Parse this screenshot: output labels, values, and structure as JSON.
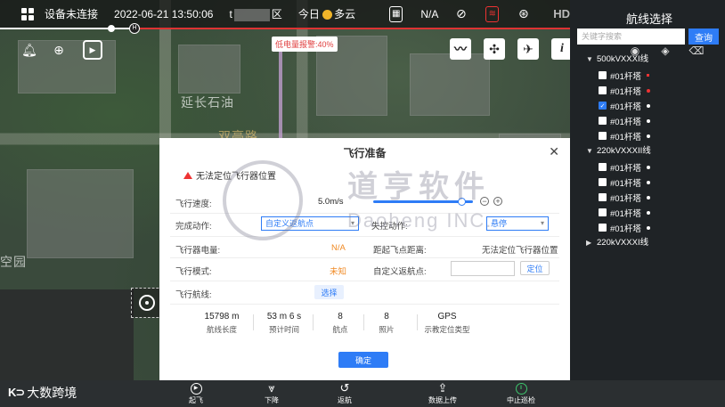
{
  "topbar": {
    "device_status": "设备未连接",
    "datetime": "2022-06-21  13:50:06",
    "district_prefix": "t",
    "district_suffix": "区",
    "weather_day": "今日",
    "weather": "多云",
    "gps_value": "N/A",
    "hd_label": "HD"
  },
  "map": {
    "low_battery_warning": "低电量报警:40%",
    "labels": [
      "延长石油",
      "双亭路",
      "空园"
    ]
  },
  "panel": {
    "title": "航线选择",
    "search_placeholder": "关键字搜索",
    "search_button": "查询",
    "groups": [
      {
        "name": "500kVXXXI线",
        "expanded": true,
        "items": [
          {
            "label": "#01杆塔",
            "checked": false,
            "marker": "red-square"
          },
          {
            "label": "#01杆塔",
            "checked": false,
            "marker": "red"
          },
          {
            "label": "#01杆塔",
            "checked": true,
            "marker": "white"
          },
          {
            "label": "#01杆塔",
            "checked": false,
            "marker": "white"
          },
          {
            "label": "#01杆塔",
            "checked": false,
            "marker": "white"
          }
        ]
      },
      {
        "name": "220kVXXXII线",
        "expanded": true,
        "items": [
          {
            "label": "#01杆塔",
            "checked": false,
            "marker": "white"
          },
          {
            "label": "#01杆塔",
            "checked": false,
            "marker": "white"
          },
          {
            "label": "#01杆塔",
            "checked": false,
            "marker": "white"
          },
          {
            "label": "#01杆塔",
            "checked": false,
            "marker": "white"
          },
          {
            "label": "#01杆塔",
            "checked": false,
            "marker": "white"
          }
        ]
      },
      {
        "name": "220kVXXXI线",
        "expanded": false,
        "items": []
      }
    ]
  },
  "dialog": {
    "title": "飞行准备",
    "warning": "无法定位飞行器位置",
    "speed_label": "飞行速度:",
    "speed_value": "5.0m/s",
    "finish_action_label": "完成动作:",
    "finish_action_value": "自定义返航点",
    "lost_action_label": "失控动作:",
    "lost_action_value": "悬停",
    "battery_label": "飞行器电量:",
    "battery_value": "N/A",
    "distance_label": "距起飞点距离:",
    "distance_value": "无法定位飞行器位置",
    "mode_label": "飞行模式:",
    "mode_value": "未知",
    "home_label": "自定义返航点:",
    "locate_button": "定位",
    "route_label": "飞行航线:",
    "select_button": "选择",
    "stats": [
      {
        "value": "15798 m",
        "label": "航线长度"
      },
      {
        "value": "53 m 6 s",
        "label": "预计时间"
      },
      {
        "value": "8",
        "label": "航点"
      },
      {
        "value": "8",
        "label": "照片"
      },
      {
        "value": "GPS",
        "label": "示教定位类型"
      }
    ],
    "confirm_button": "确定"
  },
  "watermark": {
    "big": "道亨软件",
    "small": "Daoheng INC."
  },
  "bottombar": {
    "brand": "大数跨境",
    "buttons": [
      {
        "label": "起飞",
        "icon": "takeoff-icon"
      },
      {
        "label": "下降",
        "icon": "descend-icon"
      },
      {
        "label": "返航",
        "icon": "return-icon"
      },
      {
        "label": "数据上传",
        "icon": "upload-icon"
      },
      {
        "label": "中止巡检",
        "icon": "pause-icon"
      }
    ]
  },
  "colors": {
    "accent": "#2e7cf6",
    "warning": "#e33333",
    "orange": "#f08a24",
    "green": "#3ec56d"
  }
}
